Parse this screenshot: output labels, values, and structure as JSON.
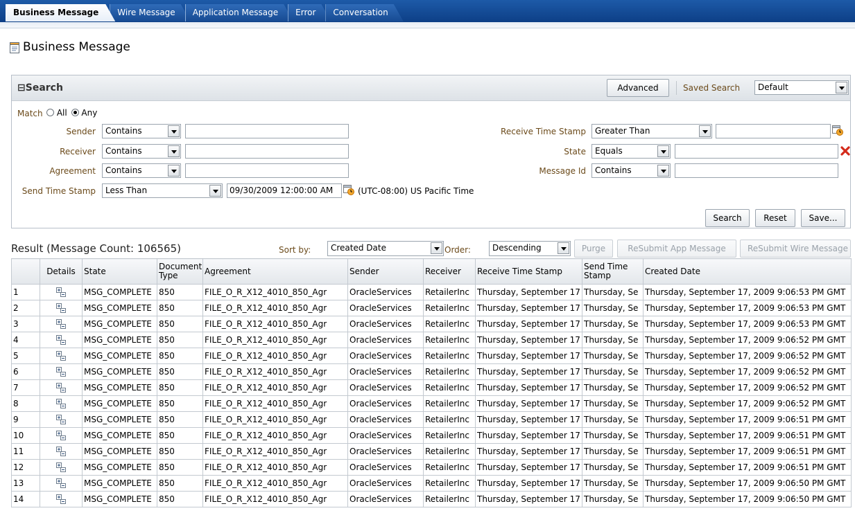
{
  "tabs": [
    "Business Message",
    "Wire Message",
    "Application Message",
    "Error",
    "Conversation"
  ],
  "page_title": "Business Message",
  "search": {
    "title": "Search",
    "advanced_label": "Advanced",
    "saved_search_label": "Saved Search",
    "saved_search_value": "Default",
    "match_label": "Match",
    "match_all": "All",
    "match_any": "Any",
    "sender_label": "Sender",
    "sender_op": "Contains",
    "receiver_label": "Receiver",
    "receiver_op": "Contains",
    "agreement_label": "Agreement",
    "agreement_op": "Contains",
    "send_ts_label": "Send Time Stamp",
    "send_ts_op": "Less Than",
    "send_ts_value": "09/30/2009 12:00:00 AM",
    "timezone": "(UTC-08:00) US Pacific Time",
    "receive_ts_label": "Receive Time Stamp",
    "receive_ts_op": "Greater Than",
    "state_label": "State",
    "state_op": "Equals",
    "message_id_label": "Message Id",
    "message_id_op": "Contains",
    "search_button": "Search",
    "reset_button": "Reset",
    "save_button": "Save..."
  },
  "result": {
    "title": "Result (Message Count: 106565)",
    "sort_by_label": "Sort by:",
    "sort_by_value": "Created Date",
    "order_label": "Order:",
    "order_value": "Descending",
    "purge_button": "Purge",
    "resubmit_app_button": "ReSubmit App Message",
    "resubmit_wire_button": "ReSubmit Wire Message"
  },
  "table": {
    "headers": [
      "",
      "Details",
      "State",
      "Document Type",
      "Agreement",
      "Sender",
      "Receiver",
      "Receive Time Stamp",
      "Send Time Stamp",
      "Created Date"
    ],
    "rows": [
      [
        "1",
        "MSG_COMPLETE",
        "850",
        "FILE_O_R_X12_4010_850_Agr",
        "OracleServices",
        "RetailerInc",
        "Thursday, September 17",
        "Thursday, Se",
        "Thursday, September 17, 2009 9:06:53 PM GMT"
      ],
      [
        "2",
        "MSG_COMPLETE",
        "850",
        "FILE_O_R_X12_4010_850_Agr",
        "OracleServices",
        "RetailerInc",
        "Thursday, September 17",
        "Thursday, Se",
        "Thursday, September 17, 2009 9:06:53 PM GMT"
      ],
      [
        "3",
        "MSG_COMPLETE",
        "850",
        "FILE_O_R_X12_4010_850_Agr",
        "OracleServices",
        "RetailerInc",
        "Thursday, September 17",
        "Thursday, Se",
        "Thursday, September 17, 2009 9:06:53 PM GMT"
      ],
      [
        "4",
        "MSG_COMPLETE",
        "850",
        "FILE_O_R_X12_4010_850_Agr",
        "OracleServices",
        "RetailerInc",
        "Thursday, September 17",
        "Thursday, Se",
        "Thursday, September 17, 2009 9:06:52 PM GMT"
      ],
      [
        "5",
        "MSG_COMPLETE",
        "850",
        "FILE_O_R_X12_4010_850_Agr",
        "OracleServices",
        "RetailerInc",
        "Thursday, September 17",
        "Thursday, Se",
        "Thursday, September 17, 2009 9:06:52 PM GMT"
      ],
      [
        "6",
        "MSG_COMPLETE",
        "850",
        "FILE_O_R_X12_4010_850_Agr",
        "OracleServices",
        "RetailerInc",
        "Thursday, September 17",
        "Thursday, Se",
        "Thursday, September 17, 2009 9:06:52 PM GMT"
      ],
      [
        "7",
        "MSG_COMPLETE",
        "850",
        "FILE_O_R_X12_4010_850_Agr",
        "OracleServices",
        "RetailerInc",
        "Thursday, September 17",
        "Thursday, Se",
        "Thursday, September 17, 2009 9:06:52 PM GMT"
      ],
      [
        "8",
        "MSG_COMPLETE",
        "850",
        "FILE_O_R_X12_4010_850_Agr",
        "OracleServices",
        "RetailerInc",
        "Thursday, September 17",
        "Thursday, Se",
        "Thursday, September 17, 2009 9:06:52 PM GMT"
      ],
      [
        "9",
        "MSG_COMPLETE",
        "850",
        "FILE_O_R_X12_4010_850_Agr",
        "OracleServices",
        "RetailerInc",
        "Thursday, September 17",
        "Thursday, Se",
        "Thursday, September 17, 2009 9:06:51 PM GMT"
      ],
      [
        "10",
        "MSG_COMPLETE",
        "850",
        "FILE_O_R_X12_4010_850_Agr",
        "OracleServices",
        "RetailerInc",
        "Thursday, September 17",
        "Thursday, Se",
        "Thursday, September 17, 2009 9:06:51 PM GMT"
      ],
      [
        "11",
        "MSG_COMPLETE",
        "850",
        "FILE_O_R_X12_4010_850_Agr",
        "OracleServices",
        "RetailerInc",
        "Thursday, September 17",
        "Thursday, Se",
        "Thursday, September 17, 2009 9:06:51 PM GMT"
      ],
      [
        "12",
        "MSG_COMPLETE",
        "850",
        "FILE_O_R_X12_4010_850_Agr",
        "OracleServices",
        "RetailerInc",
        "Thursday, September 17",
        "Thursday, Se",
        "Thursday, September 17, 2009 9:06:51 PM GMT"
      ],
      [
        "13",
        "MSG_COMPLETE",
        "850",
        "FILE_O_R_X12_4010_850_Agr",
        "OracleServices",
        "RetailerInc",
        "Thursday, September 17",
        "Thursday, Se",
        "Thursday, September 17, 2009 9:06:50 PM GMT"
      ],
      [
        "14",
        "MSG_COMPLETE",
        "850",
        "FILE_O_R_X12_4010_850_Agr",
        "OracleServices",
        "RetailerInc",
        "Thursday, September 17",
        "Thursday, Se",
        "Thursday, September 17, 2009 9:06:50 PM GMT"
      ]
    ]
  },
  "colors": {
    "tabbar": "#0d3f86",
    "label_brown": "#6b4a1a",
    "delete_red": "#d42a1a"
  }
}
